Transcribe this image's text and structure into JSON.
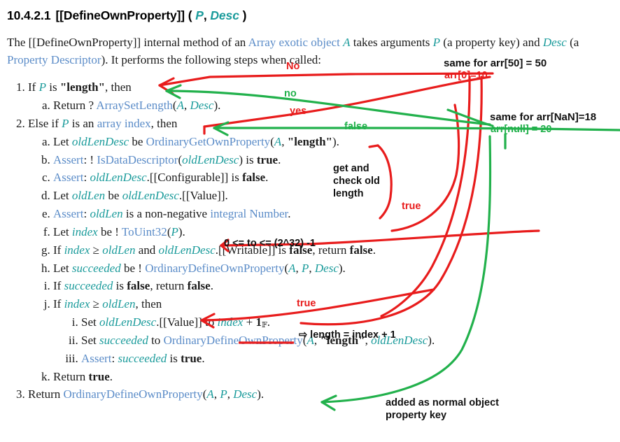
{
  "document": {
    "section_number": "10.4.2.1",
    "section_title": "[[DefineOwnProperty]] ( ",
    "section_param_p": "P",
    "section_comma": ", ",
    "section_param_desc": "Desc",
    "section_close": " )",
    "intro": {
      "t1": "The [[DefineOwnProperty]] internal method of an ",
      "link1": "Array exotic object",
      "t2": " ",
      "varA": "A",
      "t3": " takes arguments ",
      "varP": "P",
      "t4": " (a property key) and ",
      "varDesc": "Desc",
      "t5": " (a ",
      "link2": "Property Descriptor",
      "t6": "). It performs the following steps when called:"
    },
    "steps": {
      "s1": {
        "t1": "If ",
        "v1": "P",
        "t2": " is ",
        "b1": "\"length\"",
        "t3": ", then"
      },
      "s1a": {
        "t1": "Return ? ",
        "link1": "ArraySetLength",
        "t2": "(",
        "v1": "A",
        "t3": ", ",
        "v2": "Desc",
        "t4": ")."
      },
      "s2": {
        "t1": "Else if ",
        "v1": "P",
        "t2": " is an ",
        "link1": "array index",
        "t3": ", then"
      },
      "s2a": {
        "t1": "Let ",
        "v1": "oldLenDesc",
        "t2": " be ",
        "link1": "OrdinaryGetOwnProperty",
        "t3": "(",
        "v2": "A",
        "t4": ", ",
        "b1": "\"length\"",
        "t5": ")."
      },
      "s2b": {
        "t1": "",
        "link1": "Assert",
        "t2": ": ! ",
        "link2": "IsDataDescriptor",
        "t3": "(",
        "v1": "oldLenDesc",
        "t4": ") is ",
        "b1": "true",
        "t5": "."
      },
      "s2c": {
        "t1": "",
        "link1": "Assert",
        "t2": ": ",
        "v1": "oldLenDesc",
        "t3": ".[[Configurable]] is ",
        "b1": "false",
        "t4": "."
      },
      "s2d": {
        "t1": "Let ",
        "v1": "oldLen",
        "t2": " be ",
        "v2": "oldLenDesc",
        "t3": ".[[Value]]."
      },
      "s2e": {
        "t1": "",
        "link1": "Assert",
        "t2": ": ",
        "v1": "oldLen",
        "t3": " is a non-negative ",
        "link2": "integral Number",
        "t4": "."
      },
      "s2f": {
        "t1": "Let ",
        "v1": "index",
        "t2": " be ! ",
        "link1": "ToUint32",
        "t3": "(",
        "v2": "P",
        "t4": ")."
      },
      "s2g": {
        "t1": "If ",
        "v1": "index",
        "t2": " ≥ ",
        "v2": "oldLen",
        "t3": " and ",
        "v3": "oldLenDesc",
        "t4": ".[[Writable]] is ",
        "b1": "false",
        "t5": ", return ",
        "b2": "false",
        "t6": "."
      },
      "s2h": {
        "t1": "Let ",
        "v1": "succeeded",
        "t2": " be ! ",
        "link1": "OrdinaryDefineOwnProperty",
        "t3": "(",
        "v2": "A",
        "t4": ", ",
        "v3": "P",
        "t5": ", ",
        "v4": "Desc",
        "t6": ")."
      },
      "s2i": {
        "t1": "If ",
        "v1": "succeeded",
        "t2": " is ",
        "b1": "false",
        "t3": ", return ",
        "b2": "false",
        "t4": "."
      },
      "s2j": {
        "t1": "If ",
        "v1": "index",
        "t2": " ≥ ",
        "v2": "oldLen",
        "t3": ", then"
      },
      "s2j_i": {
        "t1": "Set ",
        "v1": "oldLenDesc",
        "t2": ".[[Value]] to ",
        "v3": "index",
        "t3": " + ",
        "b1": "1",
        "sub": "𝔽",
        "t4": "."
      },
      "s2j_ii": {
        "t1": "Set ",
        "v1": "succeeded",
        "t2": " to ",
        "link1": "OrdinaryDefineOwnProperty",
        "t3": "(",
        "v2": "A",
        "t4": ", ",
        "b1": "\"length\"",
        "t5": ", ",
        "v3": "oldLenDesc",
        "t6": ")."
      },
      "s2j_iii": {
        "t1": "",
        "link1": "Assert",
        "t2": ": ",
        "v1": "succeeded",
        "t3": " is ",
        "b1": "true",
        "t4": "."
      },
      "s2k": {
        "t1": "Return ",
        "b1": "true",
        "t2": "."
      },
      "s3": {
        "t1": "Return ",
        "link1": "OrdinaryDefineOwnProperty",
        "t2": "(",
        "v1": "A",
        "t3": ", ",
        "v2": "P",
        "t4": ", ",
        "v3": "Desc",
        "t5": ")."
      }
    }
  },
  "annotations": {
    "no_red": "No",
    "no_green": "no",
    "yes_red": "yes",
    "false_green": "false",
    "same_arr50": "same for arr[50] = 50",
    "arr0": "arr[0]=10",
    "same_arrnan": "same for arr[NaN]=18",
    "arrnull": "arr[null] = 20",
    "get_check_old_length": "get and\ncheck old\nlength",
    "true_1": "true",
    "true_2": "true",
    "uint32_range": "0 <= to <= (2^32) -1",
    "length_index_plus_1": "⇨ length = index + 1",
    "added_as_normal": "added as normal object\nproperty key"
  },
  "colors": {
    "red": "#e81c1c",
    "green": "#22b14c",
    "black": "#111111",
    "link_blue": "#5b8cc8",
    "var_teal": "#1a9b9b",
    "background": "#ffffff"
  }
}
